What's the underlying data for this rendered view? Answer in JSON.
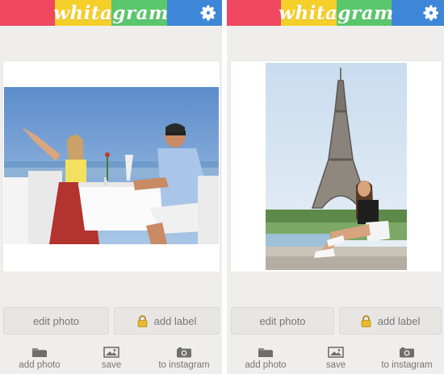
{
  "app": {
    "logo": "whitagram"
  },
  "colors": {
    "red": "#ef4760",
    "yellow": "#f5cf2a",
    "green": "#5bc76d",
    "blue": "#3d86d8",
    "background": "#efeeec"
  },
  "screens": [
    {
      "photo": "couple dining at a white-clothed table by the sea",
      "buttons": {
        "edit": "edit photo",
        "label": "add label"
      },
      "nav": [
        {
          "label": "add photo",
          "icon": "folder-icon"
        },
        {
          "label": "save",
          "icon": "image-icon"
        },
        {
          "label": "to instagram",
          "icon": "camera-icon"
        }
      ]
    },
    {
      "photo": "woman sitting in front of the Eiffel Tower",
      "buttons": {
        "edit": "edit photo",
        "label": "add label"
      },
      "nav": [
        {
          "label": "add photo",
          "icon": "folder-icon"
        },
        {
          "label": "save",
          "icon": "image-icon"
        },
        {
          "label": "to instagram",
          "icon": "camera-icon"
        }
      ]
    }
  ]
}
